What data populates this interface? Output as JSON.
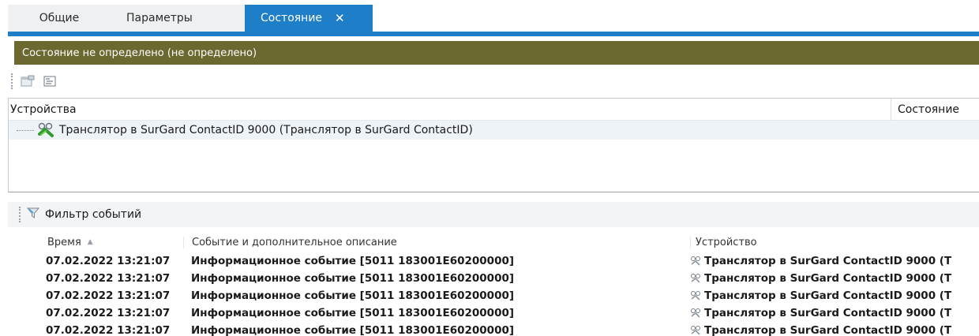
{
  "tabs": [
    {
      "label": "Общие"
    },
    {
      "label": "Параметры"
    },
    {
      "label": "Состояние",
      "close": "✕"
    }
  ],
  "status": {
    "text": "Состояние не определено (не определено)"
  },
  "toolbar": {
    "icons": [
      "properties-icon",
      "list-icon"
    ]
  },
  "devices": {
    "header_devices": "Устройства",
    "header_state": "Состояние",
    "rows": [
      {
        "label": "Транслятор в SurGard ContactID 9000 (Транслятор в SurGard ContactID)",
        "icon": "translator-device-icon"
      }
    ]
  },
  "events": {
    "filter_label": "Фильтр событий",
    "columns": {
      "time": "Время",
      "event": "Событие и дополнительное описание",
      "device": "Устройство"
    },
    "rows": [
      {
        "time": "07.02.2022 13:21:07",
        "event": "Информационное событие [5011 183001E60200000]",
        "device": "Транслятор в SurGard ContactID 9000 (Т"
      },
      {
        "time": "07.02.2022 13:21:07",
        "event": "Информационное событие [5011 183001E60200000]",
        "device": "Транслятор в SurGard ContactID 9000 (Т"
      },
      {
        "time": "07.02.2022 13:21:07",
        "event": "Информационное событие [5011 183001E60200000]",
        "device": "Транслятор в SurGard ContactID 9000 (Т"
      },
      {
        "time": "07.02.2022 13:21:07",
        "event": "Информационное событие [5011 183001E60200000]",
        "device": "Транслятор в SurGard ContactID 9000 (Т"
      },
      {
        "time": "07.02.2022 13:21:07",
        "event": "Информационное событие [5011 183001E60200000]",
        "device": "Транслятор в SurGard ContactID 9000 (Т"
      }
    ]
  },
  "colors": {
    "accent": "#1e7ec8",
    "status_bg": "#6b6830"
  }
}
